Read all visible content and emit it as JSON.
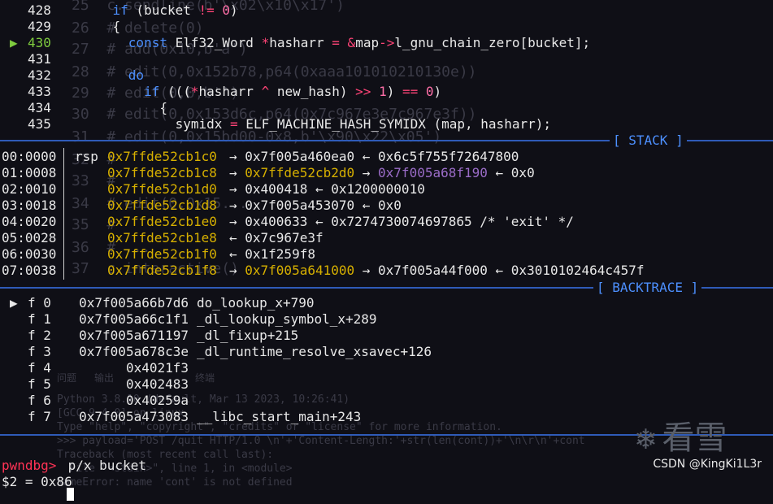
{
  "source": {
    "current_line": "430",
    "lines": [
      {
        "no": "428",
        "parts": [
          {
            "t": "    "
          },
          {
            "t": "if",
            "c": "kw"
          },
          {
            "t": " (bucket "
          },
          {
            "t": "!=",
            "c": "op"
          },
          {
            "t": " "
          },
          {
            "t": "0",
            "c": "num"
          },
          {
            "t": ")"
          }
        ]
      },
      {
        "no": "429",
        "parts": [
          {
            "t": "    {"
          }
        ]
      },
      {
        "no": "430",
        "parts": [
          {
            "t": "      "
          },
          {
            "t": "const",
            "c": "kw"
          },
          {
            "t": " Elf32_Word "
          },
          {
            "t": "*",
            "c": "op"
          },
          {
            "t": "hasharr "
          },
          {
            "t": "=",
            "c": "op"
          },
          {
            "t": " "
          },
          {
            "t": "&",
            "c": "op"
          },
          {
            "t": "map"
          },
          {
            "t": "->",
            "c": "op"
          },
          {
            "t": "l_gnu_chain_zero[bucket];"
          }
        ]
      },
      {
        "no": "431",
        "parts": [
          {
            "t": ""
          }
        ]
      },
      {
        "no": "432",
        "parts": [
          {
            "t": "      "
          },
          {
            "t": "do",
            "c": "kw"
          }
        ]
      },
      {
        "no": "433",
        "parts": [
          {
            "t": "        "
          },
          {
            "t": "if",
            "c": "kw"
          },
          {
            "t": " ((("
          },
          {
            "t": "*",
            "c": "op"
          },
          {
            "t": "hasharr "
          },
          {
            "t": "^",
            "c": "op"
          },
          {
            "t": " new_hash) "
          },
          {
            "t": ">>",
            "c": "op"
          },
          {
            "t": " "
          },
          {
            "t": "1",
            "c": "num"
          },
          {
            "t": ") "
          },
          {
            "t": "==",
            "c": "op"
          },
          {
            "t": " "
          },
          {
            "t": "0",
            "c": "num"
          },
          {
            "t": ")"
          }
        ]
      },
      {
        "no": "434",
        "parts": [
          {
            "t": "          {"
          }
        ]
      },
      {
        "no": "435",
        "parts": [
          {
            "t": "            symidx "
          },
          {
            "t": "=",
            "c": "op"
          },
          {
            "t": " ELF_MACHINE_HASH_SYMIDX (map, hasharr);"
          }
        ]
      }
    ]
  },
  "stack": {
    "title": "[ STACK ]",
    "rows": [
      {
        "idx": "00:0000",
        "reg": "rsp",
        "addr": "0x7ffde52cb1c0",
        "chain": [
          {
            "t": "→ ",
            "c": ""
          },
          {
            "t": "0x7f005a460ea0",
            "c": ""
          },
          {
            "t": " ← ",
            "c": ""
          },
          {
            "t": "0x6c5f755f72647800",
            "c": ""
          }
        ]
      },
      {
        "idx": "01:0008",
        "reg": "",
        "addr": "0x7ffde52cb1c8",
        "chain": [
          {
            "t": "→ ",
            "c": ""
          },
          {
            "t": "0x7ffde52cb2d0",
            "c": "yel"
          },
          {
            "t": " → ",
            "c": ""
          },
          {
            "t": "0x7f005a68f190",
            "c": "pur"
          },
          {
            "t": " ← ",
            "c": ""
          },
          {
            "t": "0x0",
            "c": ""
          }
        ]
      },
      {
        "idx": "02:0010",
        "reg": "",
        "addr": "0x7ffde52cb1d0",
        "chain": [
          {
            "t": "→ ",
            "c": ""
          },
          {
            "t": "0x400418",
            "c": ""
          },
          {
            "t": " ← ",
            "c": ""
          },
          {
            "t": "0x1200000010",
            "c": ""
          }
        ]
      },
      {
        "idx": "03:0018",
        "reg": "",
        "addr": "0x7ffde52cb1d8",
        "chain": [
          {
            "t": "→ ",
            "c": ""
          },
          {
            "t": "0x7f005a453070",
            "c": ""
          },
          {
            "t": " ← ",
            "c": ""
          },
          {
            "t": "0x0",
            "c": ""
          }
        ]
      },
      {
        "idx": "04:0020",
        "reg": "",
        "addr": "0x7ffde52cb1e0",
        "chain": [
          {
            "t": "→ ",
            "c": ""
          },
          {
            "t": "0x400633",
            "c": ""
          },
          {
            "t": " ← ",
            "c": ""
          },
          {
            "t": "0x7274730074697865 /* 'exit' */",
            "c": ""
          }
        ]
      },
      {
        "idx": "05:0028",
        "reg": "",
        "addr": "0x7ffde52cb1e8",
        "chain": [
          {
            "t": "← ",
            "c": ""
          },
          {
            "t": "0x7c967e3f",
            "c": ""
          }
        ]
      },
      {
        "idx": "06:0030",
        "reg": "",
        "addr": "0x7ffde52cb1f0",
        "chain": [
          {
            "t": "← ",
            "c": ""
          },
          {
            "t": "0x1f259f8",
            "c": ""
          }
        ]
      },
      {
        "idx": "07:0038",
        "reg": "",
        "addr": "0x7ffde52cb1f8",
        "chain": [
          {
            "t": "→ ",
            "c": ""
          },
          {
            "t": "0x7f005a641000",
            "c": "yel"
          },
          {
            "t": " → ",
            "c": ""
          },
          {
            "t": "0x7f005a44f000",
            "c": ""
          },
          {
            "t": " ← ",
            "c": ""
          },
          {
            "t": "0x3010102464c457f",
            "c": ""
          }
        ]
      }
    ]
  },
  "backtrace": {
    "title": "[ BACKTRACE ]",
    "rows": [
      {
        "mark": "▶",
        "frame": "f 0",
        "addr": "0x7f005a66b7d6",
        "sym": "do_lookup_x+790"
      },
      {
        "mark": "",
        "frame": "f 1",
        "addr": "0x7f005a66c1f1",
        "sym": "_dl_lookup_symbol_x+289"
      },
      {
        "mark": "",
        "frame": "f 2",
        "addr": "0x7f005a671197",
        "sym": "_dl_fixup+215"
      },
      {
        "mark": "",
        "frame": "f 3",
        "addr": "0x7f005a678c3e",
        "sym": "_dl_runtime_resolve_xsavec+126"
      },
      {
        "mark": "",
        "frame": "f 4",
        "addr": "0x4021f3",
        "sym": ""
      },
      {
        "mark": "",
        "frame": "f 5",
        "addr": "0x402483",
        "sym": ""
      },
      {
        "mark": "",
        "frame": "f 6",
        "addr": "0x40259a",
        "sym": ""
      },
      {
        "mark": "",
        "frame": "f 7",
        "addr": "0x7f005a473083",
        "sym": "__libc_start_main+243"
      }
    ]
  },
  "terminal": {
    "prompt": "pwndbg>",
    "command": " p/x bucket",
    "result": "$2 = 0x86"
  },
  "ghost_lines": [
    "25  c.sendline(b'\\x02\\x10\\x17')",
    "26  # delete(0)",
    "27  # add(0x10,b'a')",
    "28  # edit(0,0x152b78,p64(0xaaa101010210130e))",
    "29  # edit(0,0,b'')",
    "30  # edit(0,0x153d6c,p64(0x7c967e3e7c967e3f))",
    "31  # edit(0,0x15bd00-0x8,b'\\x90\\x22\\x05')",
    "32  #",
    "33  #",
    "34  # edit(0,0x15...",
    "35  #",
    "36  # ...",
    "37  c.interactive()",
    "Python 3.8.10 (default, Mar 13 2023, 10:26:41)",
    "[GCC 9.4.0] on linux",
    "Type \"help\", \"copyright\", \"credits\" or \"license\" for more information.",
    ">>> payload='POST /quit HTTP/1.0 \\n'+'Content-Length:'+str(len(cont))+'\\n\\r\\n'+cont",
    "Traceback (most recent call last):",
    "  File \"<stdin>\", line 1, in <module>",
    "NameError: name 'cont' is not defined",
    "问题",
    "输出",
    "终端"
  ],
  "watermark": {
    "logo_text": "看雪",
    "credit": "CSDN @KingKi1L3r"
  },
  "colors": {
    "background": "#0f0f16",
    "separator": "#2f5bb8",
    "keyword": "#4d90ff",
    "operator": "#ff4477",
    "stack_address": "#d7b000",
    "heap_address": "#9b6cc8",
    "current_line": "#7fcc3f",
    "prompt": "#ff3355"
  }
}
